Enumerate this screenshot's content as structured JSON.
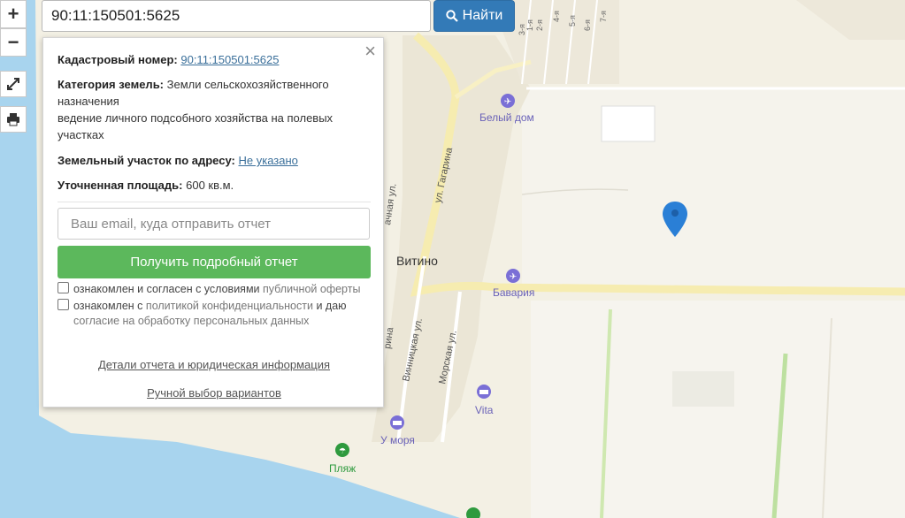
{
  "search": {
    "value": "90:11:150501:5625",
    "button_label": "Найти"
  },
  "map_controls": {
    "zoom_in": "+",
    "zoom_out": "−"
  },
  "panel": {
    "cadastral_label": "Кадастровый номер:",
    "cadastral_value": "90:11:150501:5625",
    "category_label": "Категория земель:",
    "category_value": "Земли сельскохозяйственного назначения",
    "category_use": "ведение личного подсобного хозяйства на полевых участках",
    "address_label": "Земельный участок по адресу:",
    "address_value": "Не указано",
    "area_label": "Уточненная площадь:",
    "area_value": "600 кв.м.",
    "email_placeholder": "Ваш email, куда отправить отчет",
    "get_report_label": "Получить подробный отчет",
    "consent1_text": "ознакомлен и согласен с условиями",
    "consent1_link": "публичной оферты",
    "consent2_text": "ознакомлен с",
    "consent2_link": "политикой конфиденциальности",
    "consent2_rest": "и даю",
    "consent2_line2": "согласие на обработку персональных данных",
    "details_link": "Детали отчета и юридическая информация",
    "manual_link": "Ручной выбор вариантов"
  },
  "map_labels": {
    "village": "Витино",
    "street_gagarina": "ул. Гагарина",
    "street_vinnitskaya": "Винницкая ул.",
    "street_morskaya": "Морская ул.",
    "belyi_dom": "Белый дом",
    "bavariya": "Бавария",
    "vita": "Vita",
    "u_morya": "У моря",
    "plyazh": "Пляж",
    "street_partial1": "ачная ул.",
    "street_partial2": "рина",
    "row1": "1-я",
    "row2": "2-я",
    "row3": "3-я",
    "row4": "4-я",
    "row5": "5-я",
    "row6": "6-я",
    "row7": "7-я"
  },
  "colors": {
    "accent": "#337ab7",
    "success": "#5cb85c",
    "sea": "#a8d4ee",
    "road": "#f6ecb0",
    "marker": "#2a7fd6",
    "poi": "#7a6fd6",
    "beach": "#2e9a3e"
  }
}
